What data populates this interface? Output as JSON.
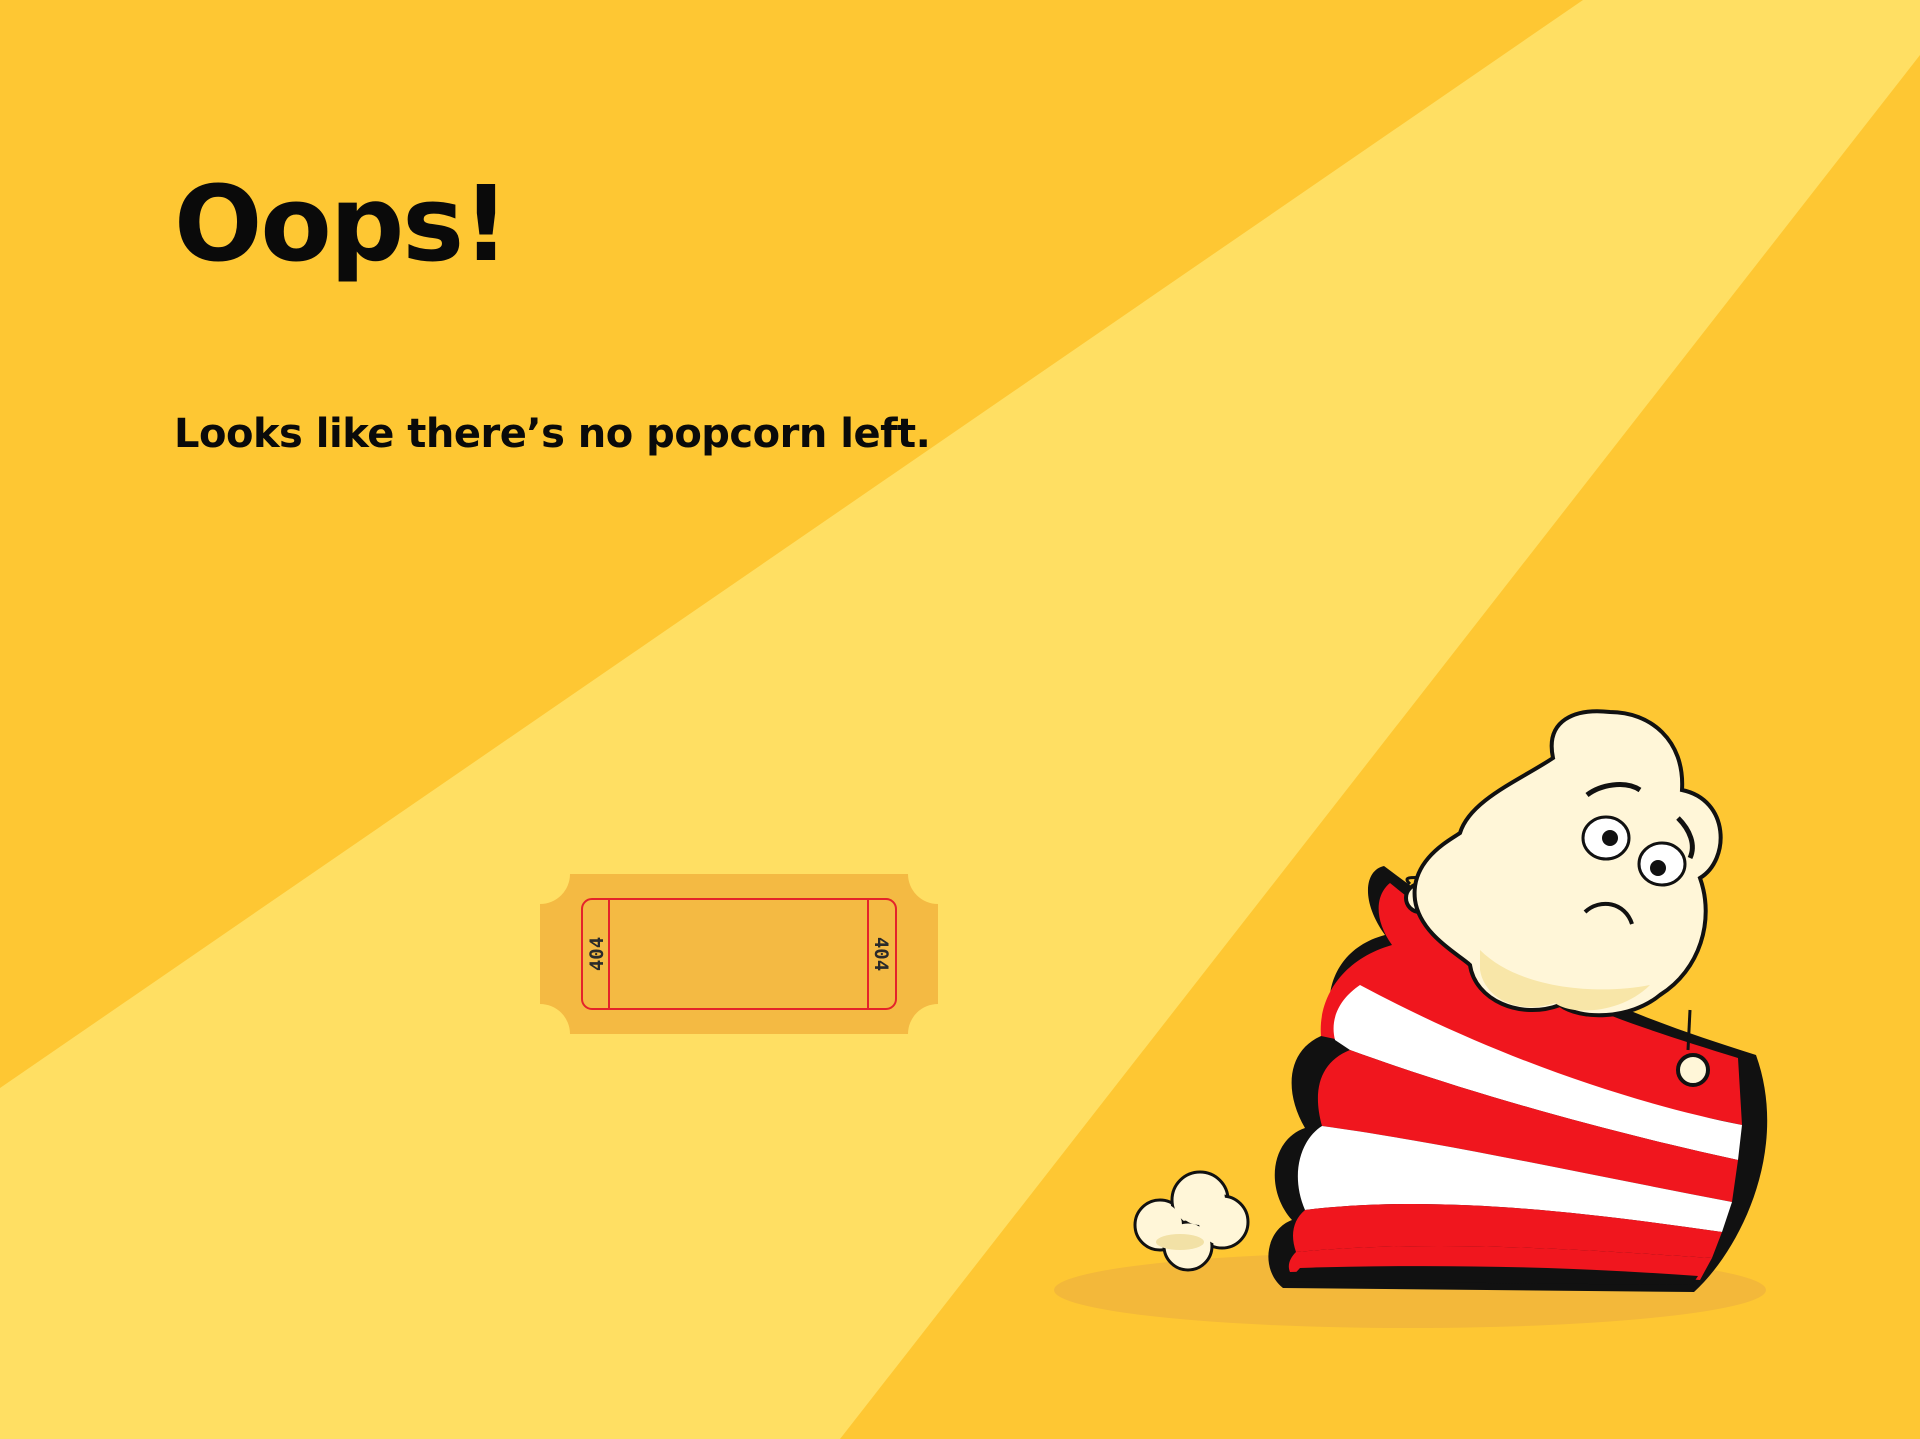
{
  "page": {
    "title": "Oops!",
    "message": "Looks like there’s no popcorn left."
  },
  "ticket": {
    "code_left": "404",
    "code_right": "404"
  },
  "colors": {
    "background": "#FEC733",
    "spotlight": "#FFDF63",
    "ticket": "#F4BA43",
    "ticket_border": "#E4232A",
    "bucket_red": "#F0161E",
    "bucket_white": "#FFFFFF",
    "popcorn": "#FFF6D8",
    "text": "#0A0A0A"
  },
  "icons": [
    "ticket-icon",
    "popcorn-bucket-icon",
    "popcorn-character-icon",
    "popcorn-kernel-icon"
  ]
}
